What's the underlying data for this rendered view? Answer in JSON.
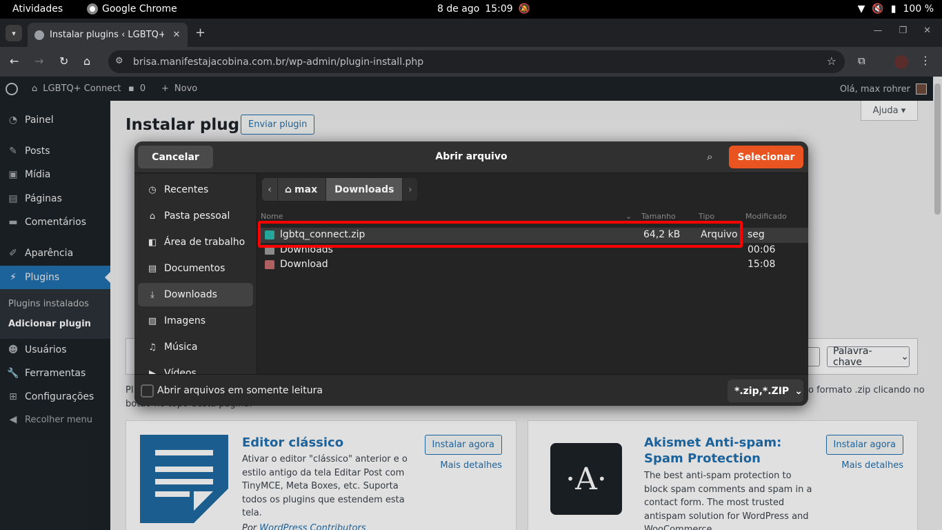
{
  "system": {
    "activities": "Atividades",
    "app_name": "Google Chrome",
    "date": "8 de ago",
    "time": "15:09",
    "battery": "100 %"
  },
  "browser": {
    "tab_title": "Instalar plugins ‹ LGBTQ+",
    "url": "brisa.manifestajacobina.com.br/wp-admin/plugin-install.php"
  },
  "adminbar": {
    "site_name": "LGBTQ+ Connect",
    "comments_count": "0",
    "new_label": "Novo",
    "howdy": "Olá, max rohrer"
  },
  "sidebar": {
    "items": [
      {
        "label": "Painel",
        "icon": "dashboard-icon"
      },
      {
        "label": "Posts",
        "icon": "pin-icon"
      },
      {
        "label": "Mídia",
        "icon": "media-icon"
      },
      {
        "label": "Páginas",
        "icon": "pages-icon"
      },
      {
        "label": "Comentários",
        "icon": "comments-icon"
      },
      {
        "label": "Aparência",
        "icon": "brush-icon"
      },
      {
        "label": "Plugins",
        "icon": "plugin-icon"
      },
      {
        "label": "Usuários",
        "icon": "users-icon"
      },
      {
        "label": "Ferramentas",
        "icon": "tools-icon"
      },
      {
        "label": "Configurações",
        "icon": "settings-icon"
      }
    ],
    "submenu": [
      "Plugins instalados",
      "Adicionar plugin"
    ],
    "collapse": "Recolher menu"
  },
  "content": {
    "title": "Instalar plugins",
    "upload_button": "Enviar plugin",
    "help": "Ajuda",
    "keyword_select": "Palavra-chave",
    "desc_start": "Pl",
    "desc_end": "o formato .zip clicando no",
    "desc_line2": "botão no topo desta página.",
    "cards": [
      {
        "name": "Editor clássico",
        "desc": "Ativar o editor \"clássico\" anterior e o estilo antigo da tela Editar Post com TinyMCE, Meta Boxes, etc. Suporta todos os plugins que estendem esta tela.",
        "install": "Instalar agora",
        "more": "Mais detalhes",
        "by_prefix": "Por",
        "author": "WordPress Contributors"
      },
      {
        "name": "Akismet Anti-spam: Spam Protection",
        "desc": "The best anti-spam protection to block spam comments and spam in a contact form. The most trusted antispam solution for WordPress and WooCommerce.",
        "install": "Instalar agora",
        "more": "Mais detalhes",
        "logo_letter": "·A·"
      }
    ]
  },
  "dialog": {
    "cancel": "Cancelar",
    "title": "Abrir arquivo",
    "select": "Selecionar",
    "places": [
      {
        "label": "Recentes",
        "icon": "clock-icon"
      },
      {
        "label": "Pasta pessoal",
        "icon": "home-icon"
      },
      {
        "label": "Área de trabalho",
        "icon": "desktop-icon"
      },
      {
        "label": "Documentos",
        "icon": "document-icon"
      },
      {
        "label": "Downloads",
        "icon": "download-icon",
        "selected": true
      },
      {
        "label": "Imagens",
        "icon": "image-icon"
      },
      {
        "label": "Música",
        "icon": "music-icon"
      },
      {
        "label": "Vídeos",
        "icon": "video-icon"
      }
    ],
    "path": [
      "max",
      "Downloads"
    ],
    "columns": {
      "name": "Nome",
      "size": "Tamanho",
      "type": "Tipo",
      "modified": "Modificado"
    },
    "files": [
      {
        "name": "lgbtq_connect.zip",
        "size": "64,2 kB",
        "type": "Arquivo",
        "modified": "seg",
        "kind": "zip"
      },
      {
        "name": "Downloads",
        "size": "",
        "type": "",
        "modified": "00:06",
        "kind": "folder"
      },
      {
        "name": "Download",
        "size": "",
        "type": "",
        "modified": "15:08",
        "kind": "folder"
      }
    ],
    "readonly_label": "Abrir arquivos em somente leitura",
    "filter": "*.zip,*.ZIP"
  },
  "colors": {
    "wp_accent": "#2271b1",
    "dialog_primary": "#e95420",
    "highlight": "#ff0000"
  }
}
